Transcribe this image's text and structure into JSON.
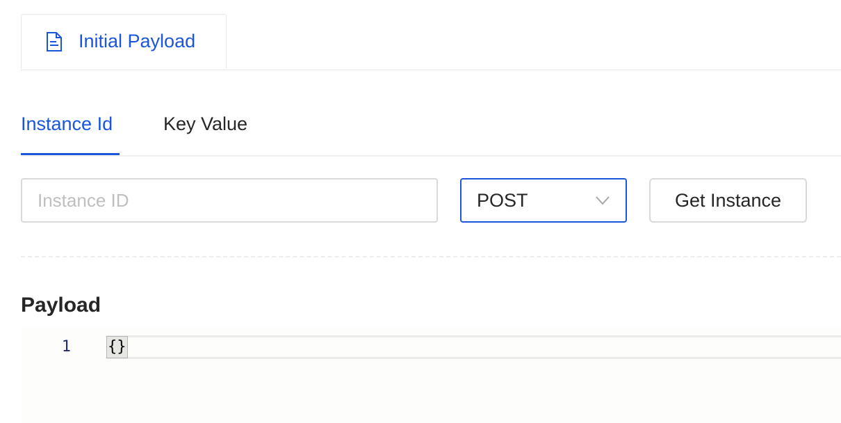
{
  "top_tabs": [
    {
      "label": "Initial Payload",
      "icon": "document-icon",
      "active": true
    }
  ],
  "sub_tabs": [
    {
      "label": "Instance Id",
      "active": true
    },
    {
      "label": "Key Value",
      "active": false
    }
  ],
  "instance_input": {
    "value": "",
    "placeholder": "Instance ID"
  },
  "method_select": {
    "value": "POST"
  },
  "get_instance_button": {
    "label": "Get Instance"
  },
  "payload": {
    "title": "Payload",
    "lines": [
      {
        "number": "1",
        "text": "{}"
      }
    ]
  },
  "colors": {
    "accent": "#1a56db",
    "border": "#d9d9d9",
    "placeholder": "#bfbfbf"
  }
}
